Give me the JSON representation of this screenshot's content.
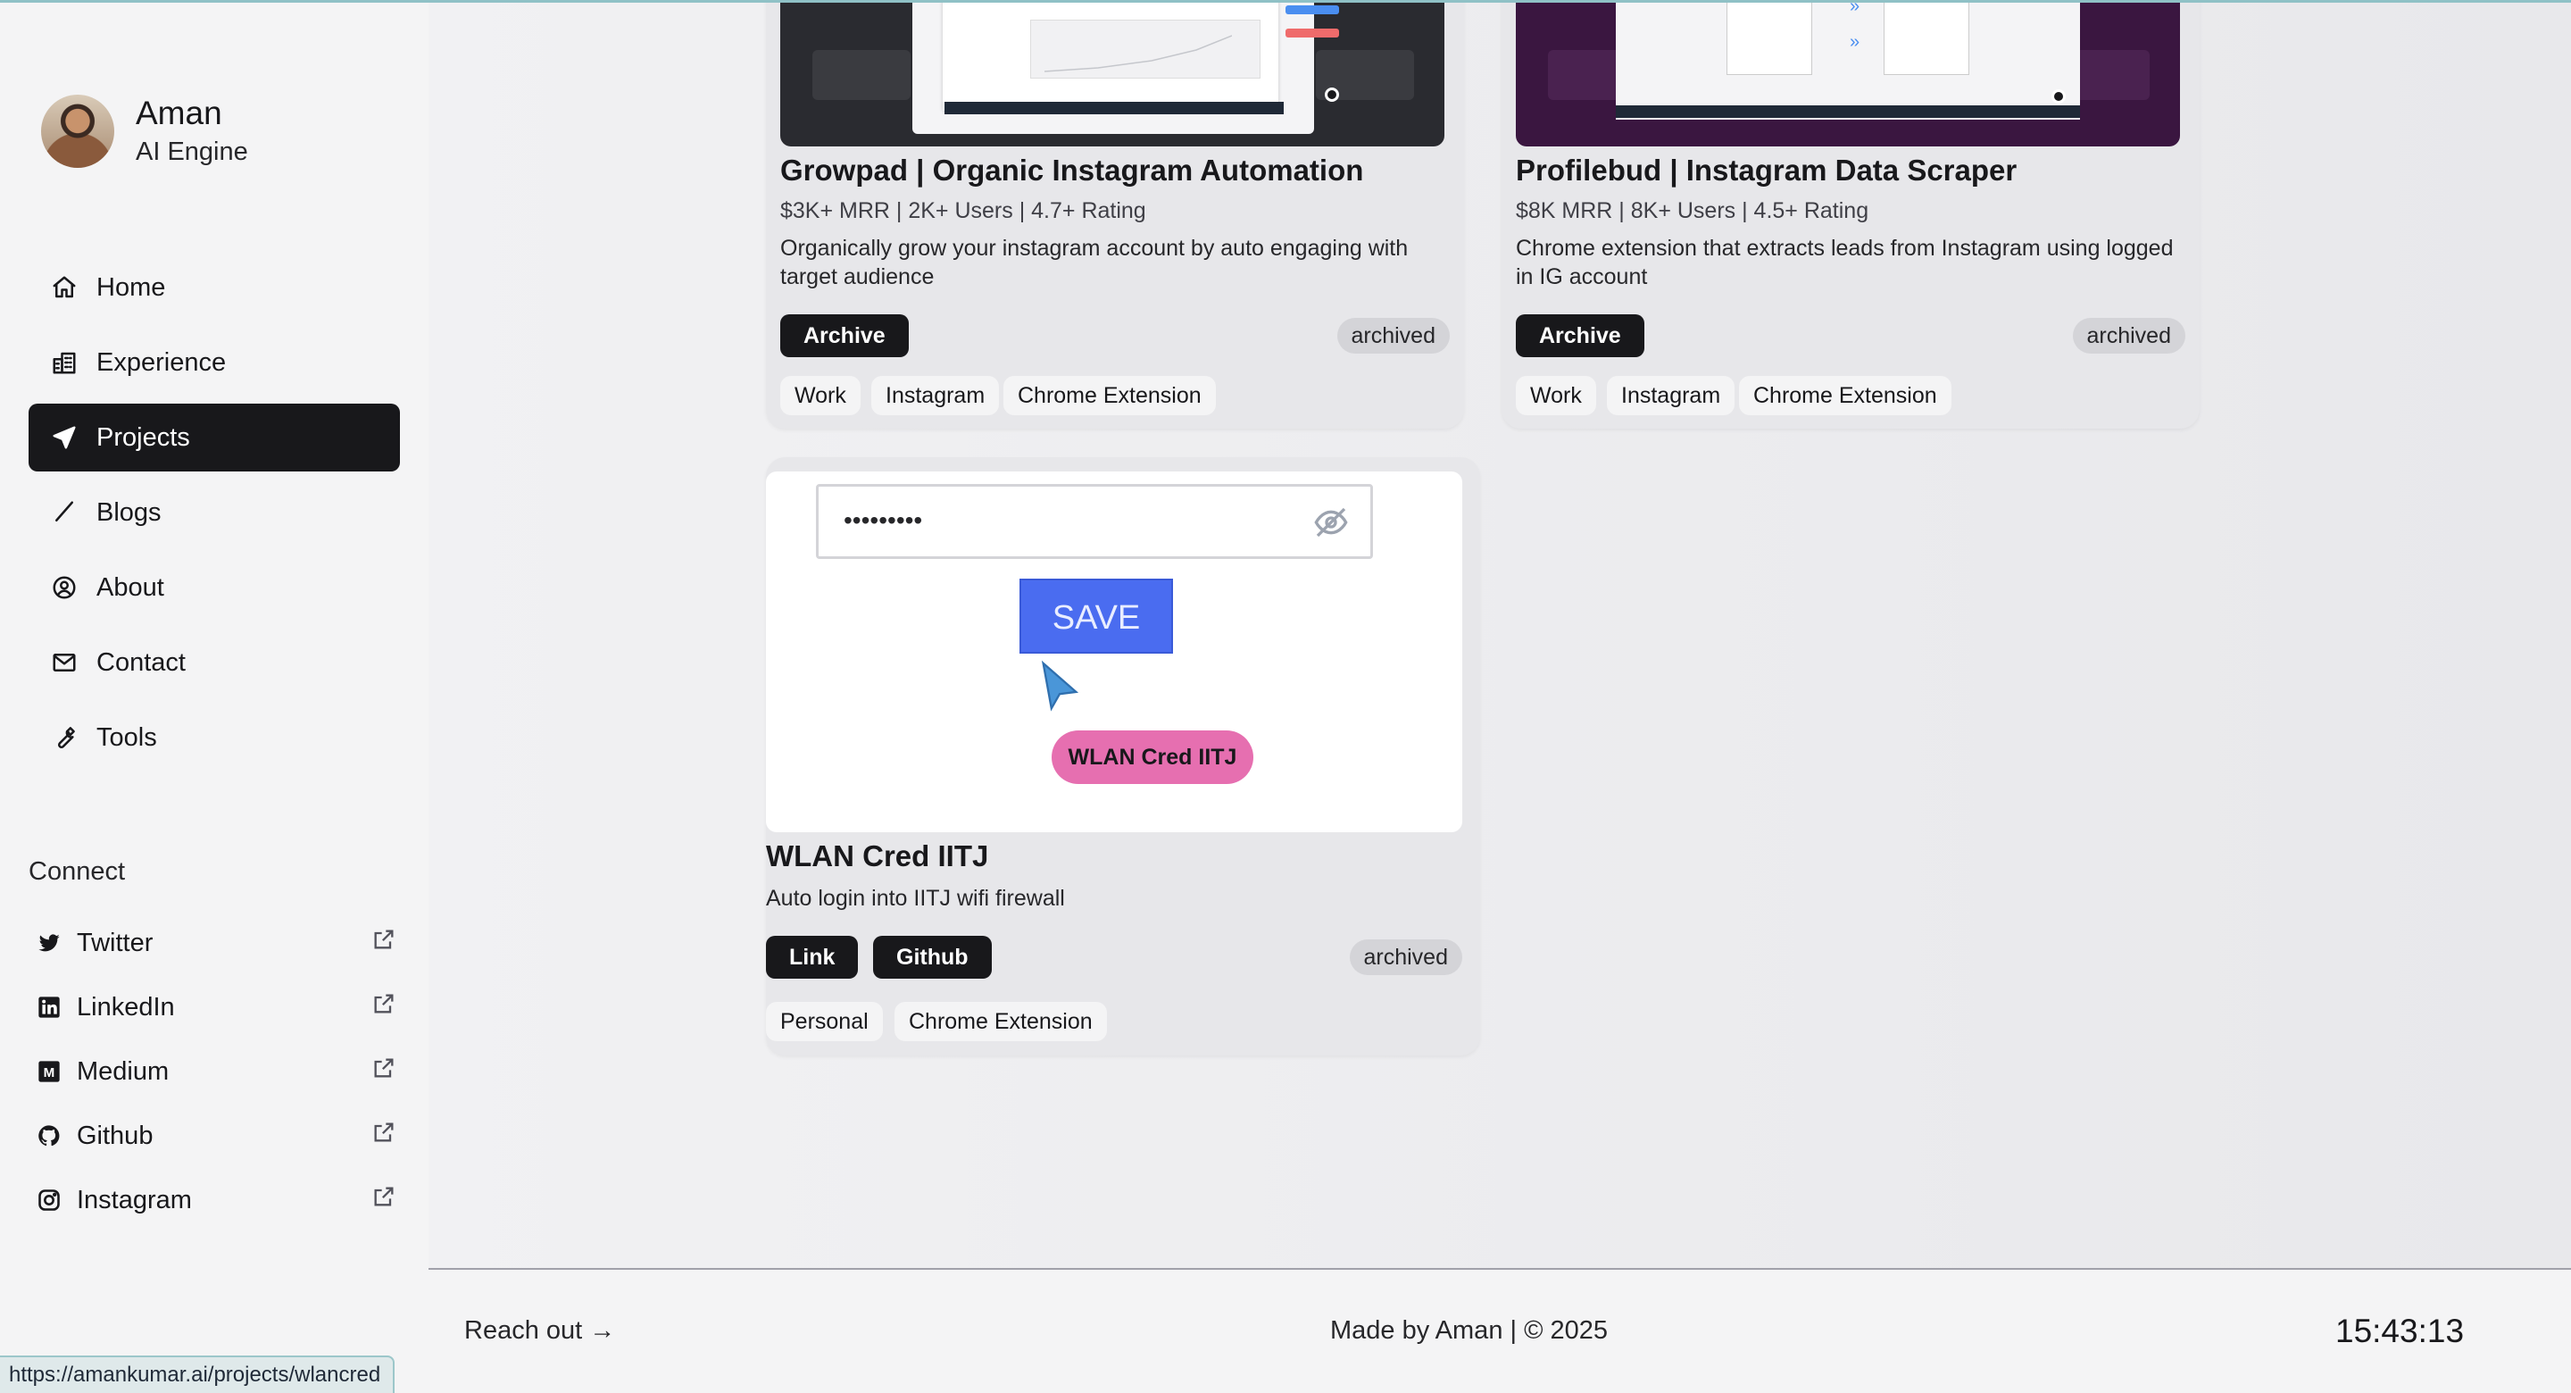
{
  "browser": {
    "status_url": "https://amankumar.ai/projects/wlancred"
  },
  "profile": {
    "name": "Aman",
    "role": "AI Engine"
  },
  "nav": [
    {
      "label": "Home",
      "icon": "home-icon",
      "active": false
    },
    {
      "label": "Experience",
      "icon": "building-icon",
      "active": false
    },
    {
      "label": "Projects",
      "icon": "navigation-arrow-icon",
      "active": true
    },
    {
      "label": "Blogs",
      "icon": "pencil-icon",
      "active": false
    },
    {
      "label": "About",
      "icon": "user-circle-icon",
      "active": false
    },
    {
      "label": "Contact",
      "icon": "mail-icon",
      "active": false
    },
    {
      "label": "Tools",
      "icon": "wrench-icon",
      "active": false
    }
  ],
  "connect": {
    "title": "Connect",
    "items": [
      {
        "label": "Twitter",
        "icon": "twitter-icon"
      },
      {
        "label": "LinkedIn",
        "icon": "linkedin-icon"
      },
      {
        "label": "Medium",
        "icon": "medium-icon"
      },
      {
        "label": "Github",
        "icon": "github-icon"
      },
      {
        "label": "Instagram",
        "icon": "instagram-icon"
      }
    ]
  },
  "projects": [
    {
      "title": "Growpad | Organic Instagram Automation",
      "meta": "$3K+ MRR | 2K+ Users | 4.7+ Rating",
      "description": "Organically grow your instagram account by auto engaging with target audience",
      "buttons": [
        "Archive"
      ],
      "status": "archived",
      "tags": [
        "Work",
        "Instagram",
        "Chrome Extension"
      ]
    },
    {
      "title": "Profilebud | Instagram Data Scraper",
      "meta": "$8K MRR | 8K+ Users | 4.5+ Rating",
      "description": "Chrome extension that extracts leads from Instagram using logged in IG account",
      "buttons": [
        "Archive"
      ],
      "status": "archived",
      "tags": [
        "Work",
        "Instagram",
        "Chrome Extension"
      ]
    },
    {
      "title": "WLAN Cred IITJ",
      "description": "Auto login into IITJ wifi firewall",
      "buttons": [
        "Link",
        "Github"
      ],
      "status": "archived",
      "tags": [
        "Personal",
        "Chrome Extension"
      ],
      "preview": {
        "password_mask": "•••••••••",
        "save_label": "SAVE",
        "pill_label": "WLAN Cred IITJ"
      }
    }
  ],
  "footer": {
    "reach_out": "Reach out →",
    "made_by": "Made by Aman | © 2025",
    "time": "15:43:13"
  },
  "colors": {
    "accent_dark": "#18181b",
    "save_blue": "#4a6cf0",
    "pill_pink": "#e66fb0",
    "profilebud_purple": "#3a1640",
    "growpad_dark": "#2a2b30"
  }
}
